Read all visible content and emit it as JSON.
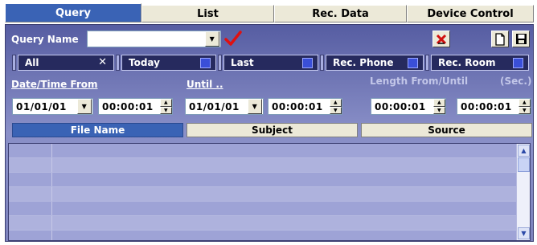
{
  "tabs": [
    {
      "label": "Query",
      "active": true
    },
    {
      "label": "List",
      "active": false
    },
    {
      "label": "Rec. Data",
      "active": false
    },
    {
      "label": "Device Control",
      "active": false
    }
  ],
  "query": {
    "name_label": "Query Name",
    "name_value": ""
  },
  "filters": [
    {
      "label": "All",
      "indicator": "x-mark"
    },
    {
      "label": "Today",
      "indicator": "square"
    },
    {
      "label": "Last",
      "indicator": "square"
    },
    {
      "label": "Rec. Phone",
      "indicator": "square"
    },
    {
      "label": "Rec. Room",
      "indicator": "square"
    }
  ],
  "datetime": {
    "from_label": "Date/Time From",
    "until_label": "Until ..",
    "length_label": "Length From/Until",
    "sec_label": "(Sec.)",
    "from_date": "01/01/01",
    "from_time": "00:00:01",
    "until_date": "01/01/01",
    "until_time": "00:00:01",
    "length_from": "00:00:01",
    "length_until": "00:00:01"
  },
  "columns": [
    {
      "label": "File Name",
      "active": true
    },
    {
      "label": "Subject",
      "active": false
    },
    {
      "label": "Source",
      "active": false
    }
  ],
  "colors": {
    "panel_dark": "#565da2",
    "panel_light": "#8a90c8",
    "accent_blue": "#3a63b5",
    "check_red": "#e01010"
  },
  "icons": [
    "chevron-down-icon",
    "checkmark-icon",
    "delete-icon",
    "new-document-icon",
    "save-disk-icon",
    "x-mark-icon",
    "spin-up-icon",
    "spin-down-icon",
    "scroll-up-icon",
    "scroll-down-icon"
  ]
}
